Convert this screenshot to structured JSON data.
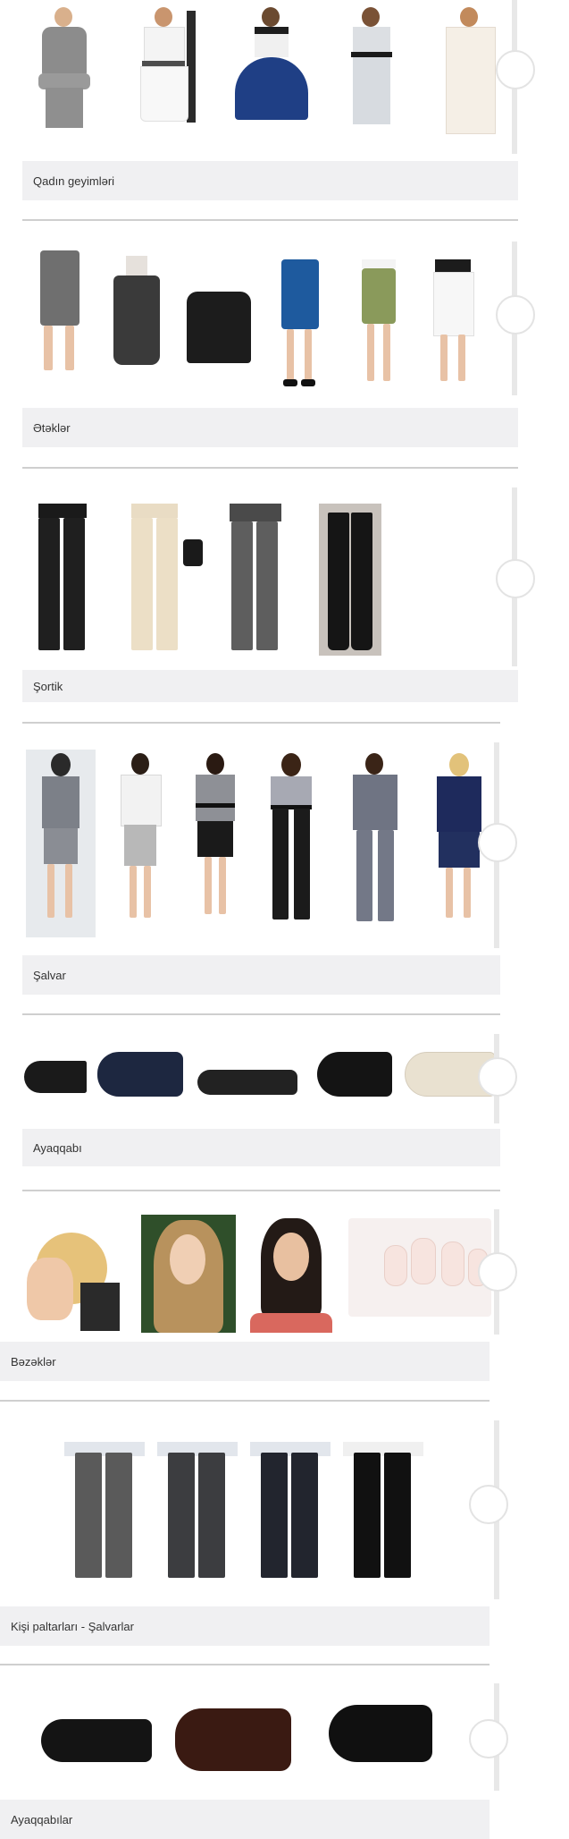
{
  "sections": [
    {
      "id": "qadin-geyimleri",
      "label": "Qadın geyimləri"
    },
    {
      "id": "etekler",
      "label": "Ətəklər"
    },
    {
      "id": "sortik",
      "label": "Şortik"
    },
    {
      "id": "salvar",
      "label": "Şalvar"
    },
    {
      "id": "ayaqqabi",
      "label": "Ayaqqabı"
    },
    {
      "id": "bezekler",
      "label": "Bəzəklər"
    },
    {
      "id": "kisi-paltarlari",
      "label": "Kişi paltarları - Şalvarlar"
    },
    {
      "id": "ayaqqabilar",
      "label": "Ayaqqabılar"
    }
  ],
  "colors": {
    "caption_bg": "#f0f0f2",
    "divider": "#cfcfcf",
    "page_bg": "#ffffff"
  }
}
